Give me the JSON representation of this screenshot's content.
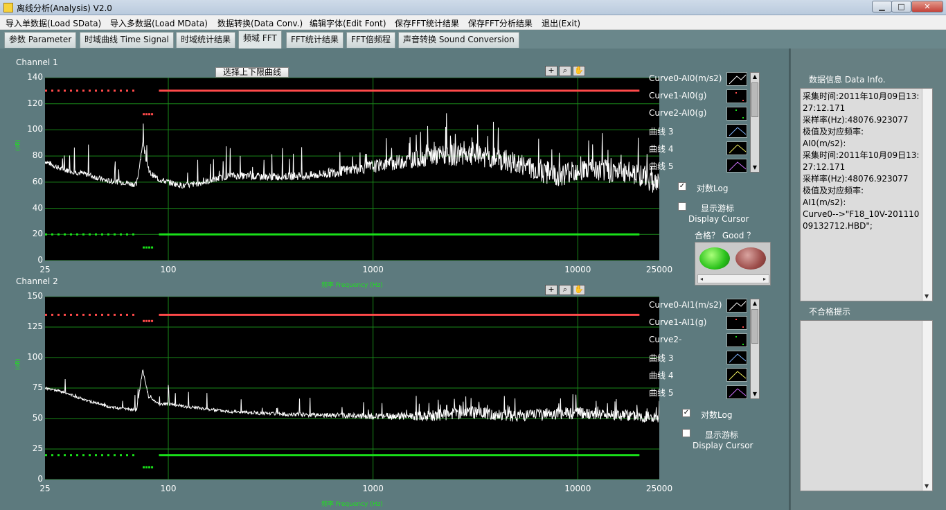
{
  "window": {
    "title": "离线分析(Analysis) V2.0",
    "min": "▁",
    "max": "□",
    "close": "✕"
  },
  "menu": [
    "导入单数据(Load SData)",
    "导入多数据(Load MData)",
    "数据转换(Data Conv.)",
    "编辑字体(Edit Font)",
    "保存FFT统计结果",
    "保存FFT分析结果",
    "退出(Exit)"
  ],
  "tabs": [
    {
      "label": "参数 Parameter",
      "active": false
    },
    {
      "label": "时域曲线 Time Signal",
      "active": false
    },
    {
      "label": "时域统计结果",
      "active": false
    },
    {
      "label": "频域 FFT",
      "active": true
    },
    {
      "label": "FFT统计结果",
      "active": false
    },
    {
      "label": "FFT倍频程",
      "active": false
    },
    {
      "label": "声音转换 Sound Conversion",
      "active": false
    }
  ],
  "limit_button": "选择上下限曲线",
  "tool_icons": [
    "crosshair-icon",
    "zoom-icon",
    "hand-pan-icon"
  ],
  "channel1": {
    "label": "Channel 1",
    "y_unit": "(dB)",
    "y_ticks": [
      "140",
      "120",
      "100",
      "80",
      "60",
      "40",
      "20",
      "0"
    ],
    "x_ticks": [
      "25",
      "100",
      "1000",
      "10000",
      "25000"
    ],
    "x_label": "频率 Frequency (Hz)",
    "legend": [
      "Curve0-AI0(m/s2)",
      "Curve1-AI0(g)",
      "Curve2-AI0(g)",
      "曲线 3",
      "曲线 4",
      "曲线 5"
    ],
    "log_label": "对数Log",
    "cursor_label_1": "显示游标",
    "cursor_label_2": "Display Cursor"
  },
  "channel2": {
    "label": "Channel 2",
    "y_unit": "(dB)",
    "y_ticks": [
      "150",
      "125",
      "100",
      "75",
      "50",
      "25",
      "0"
    ],
    "x_ticks": [
      "25",
      "100",
      "1000",
      "10000",
      "25000"
    ],
    "x_label": "频率 Frequency (Hz)",
    "legend": [
      "Curve0-AI1(m/s2)",
      "Curve1-AI1(g)",
      "Curve2-",
      "曲线 3",
      "曲线 4",
      "曲线 5"
    ],
    "log_label": "对数Log",
    "cursor_label_1": "显示游标",
    "cursor_label_2": "Display Cursor"
  },
  "good": {
    "label": "合格？ Good ？"
  },
  "info": {
    "title": "数据信息 Data Info.",
    "lines": [
      "采集时间:2011年10月09日13:27:12.171",
      "采样率(Hz):48076.923077",
      "极值及对应频率:",
      "AI0(m/s2):",
      "采集时间:2011年10月09日13:27:12.171",
      "采样率(Hz):48076.923077",
      "极值及对应频率:",
      "AI1(m/s2):",
      "Curve0-->\"F18_10V-20111009132712.HBD\";"
    ]
  },
  "fail": {
    "title": "不合格提示"
  },
  "colors": {
    "curve": "#ffffff",
    "upper_limit": "#ff4a4a",
    "lower_limit": "#19e019",
    "grid": "#1a8a1a",
    "led_good": "#29c11a",
    "led_bad": "#9c4c49"
  },
  "chart_data": [
    {
      "type": "line",
      "title": "Channel 1",
      "xlabel": "频率 Frequency (Hz)",
      "ylabel": "(dB)",
      "x_scale": "log",
      "xlim": [
        25,
        25000
      ],
      "ylim": [
        0,
        140
      ],
      "grid": true,
      "series": [
        {
          "name": "Curve0-AI0(m/s2)",
          "x": [
            25,
            30,
            40,
            50,
            60,
            70,
            75,
            80,
            90,
            100,
            120,
            150,
            200,
            300,
            500,
            1000,
            2000,
            3000,
            5000,
            8000,
            10000,
            15000,
            20000,
            25000
          ],
          "y": [
            76,
            70,
            66,
            61,
            60,
            58,
            90,
            68,
            62,
            60,
            57,
            60,
            65,
            64,
            65,
            72,
            80,
            82,
            74,
            65,
            70,
            68,
            66,
            58
          ]
        },
        {
          "name": "Curve1-AI0(g)",
          "x": [
            25,
            70,
            75,
            85,
            90,
            20000
          ],
          "y": [
            130,
            130,
            112,
            112,
            130,
            130
          ]
        },
        {
          "name": "Curve2-AI0(g)",
          "x": [
            25,
            70,
            75,
            85,
            90,
            20000
          ],
          "y": [
            20,
            20,
            10,
            10,
            20,
            20
          ]
        }
      ]
    },
    {
      "type": "line",
      "title": "Channel 2",
      "xlabel": "频率 Frequency (Hz)",
      "ylabel": "(dB)",
      "x_scale": "log",
      "xlim": [
        25,
        25000
      ],
      "ylim": [
        0,
        150
      ],
      "grid": true,
      "series": [
        {
          "name": "Curve0-AI1(m/s2)",
          "x": [
            25,
            30,
            40,
            50,
            60,
            70,
            75,
            80,
            90,
            100,
            120,
            150,
            200,
            300,
            500,
            1000,
            2000,
            3000,
            5000,
            8000,
            10000,
            15000,
            20000,
            25000
          ],
          "y": [
            75,
            72,
            65,
            60,
            58,
            57,
            90,
            68,
            62,
            62,
            60,
            58,
            56,
            54,
            53,
            52,
            52,
            55,
            52,
            54,
            55,
            53,
            52,
            50
          ]
        },
        {
          "name": "Curve1-AI1(g)",
          "x": [
            25,
            70,
            75,
            85,
            90,
            20000
          ],
          "y": [
            135,
            135,
            130,
            130,
            135,
            135
          ]
        },
        {
          "name": "Curve2-",
          "x": [
            25,
            70,
            75,
            85,
            90,
            20000
          ],
          "y": [
            20,
            20,
            10,
            10,
            20,
            20
          ]
        }
      ]
    }
  ]
}
